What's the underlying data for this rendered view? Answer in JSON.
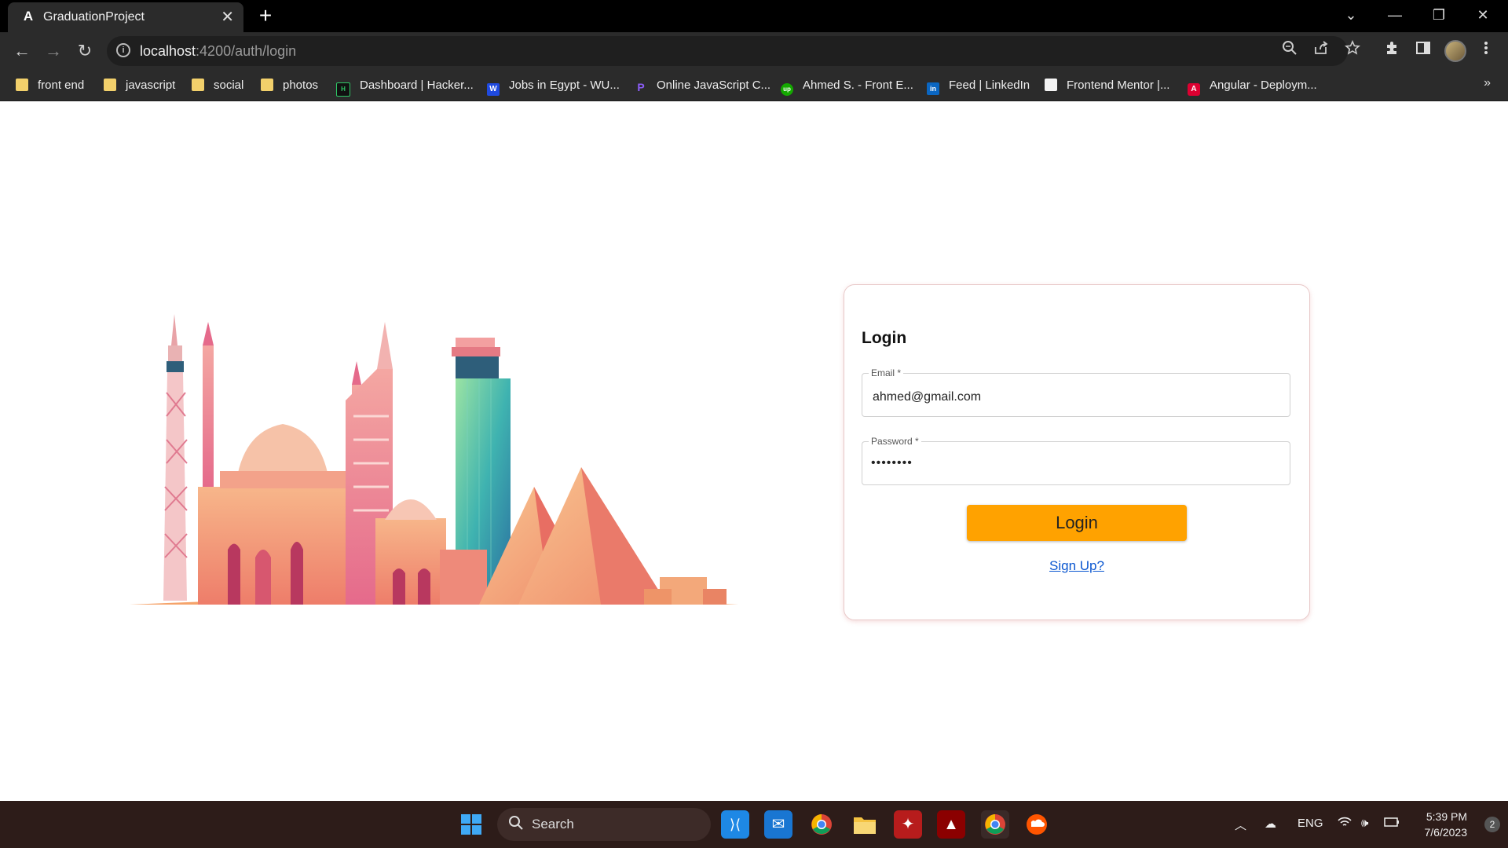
{
  "browser": {
    "tab_title": "GraduationProject",
    "tab_favicon": "A",
    "tab_close": "✕",
    "new_tab": "+",
    "url_host": "localhost",
    "url_path": ":4200/auth/login",
    "window_controls": {
      "tab_search": "⌄",
      "minimize": "—",
      "restore": "❐",
      "close": "✕"
    },
    "nav": {
      "back": "←",
      "forward": "→",
      "reload": "↻"
    },
    "bookmarks": [
      {
        "label": "front end",
        "icon": "folder-icon"
      },
      {
        "label": "javascript",
        "icon": "folder-icon"
      },
      {
        "label": "social",
        "icon": "folder-icon"
      },
      {
        "label": "photos",
        "icon": "folder-icon"
      },
      {
        "label": "Dashboard | Hacker...",
        "icon": "hackerrank-icon"
      },
      {
        "label": "Jobs in Egypt - WU...",
        "icon": "wuzzuf-icon"
      },
      {
        "label": "Online JavaScript C...",
        "icon": "programiz-icon"
      },
      {
        "label": "Ahmed S. - Front E...",
        "icon": "upwork-icon"
      },
      {
        "label": "Feed | LinkedIn",
        "icon": "linkedin-icon"
      },
      {
        "label": "Frontend Mentor |...",
        "icon": "frontend-mentor-icon"
      },
      {
        "label": "Angular - Deploym...",
        "icon": "angular-icon"
      }
    ],
    "bookmarks_more": "»"
  },
  "login": {
    "title": "Login",
    "email_label": "Email *",
    "email_value": "ahmed@gmail.com",
    "password_label": "Password *",
    "password_value": "••••••••",
    "submit_label": "Login",
    "signup_link": "Sign Up?",
    "accent_color": "#ffa200"
  },
  "taskbar": {
    "search_label": "Search",
    "tray_language": "ENG",
    "time": "5:39 PM",
    "date": "7/6/2023",
    "notification_count": "2"
  }
}
